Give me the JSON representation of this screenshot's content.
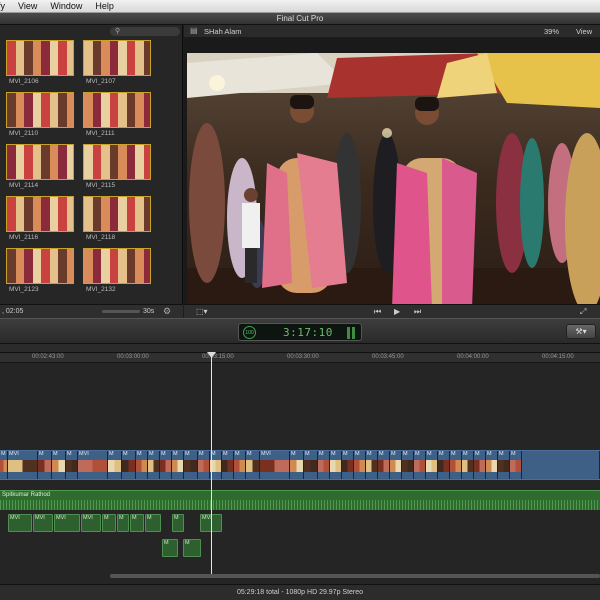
{
  "menubar": {
    "items": [
      "fy",
      "View",
      "Window",
      "Help"
    ]
  },
  "app_title": "Final Cut Pro",
  "browser": {
    "clips": [
      {
        "label": "MVI_2106"
      },
      {
        "label": "MVI_2107"
      },
      {
        "label": "MVI_2110"
      },
      {
        "label": "MVI_2111"
      },
      {
        "label": "MVI_2114"
      },
      {
        "label": "MVI_2115"
      },
      {
        "label": "MVI_2116"
      },
      {
        "label": "MVI_2118"
      },
      {
        "label": "MVI_2123"
      },
      {
        "label": "MVI_2132"
      }
    ],
    "duration": ", 02:05",
    "zoom_label": "30s"
  },
  "viewer": {
    "clip_name": "SHah Alam",
    "zoom": "39%",
    "view_label": "View"
  },
  "dashboard": {
    "percent": "100",
    "timecode": "3:17:10"
  },
  "timeline": {
    "ruler_ticks": [
      "00:02:43:00",
      "00:03:00:00",
      "00:03:15:00",
      "00:03:30:00",
      "00:03:45:00",
      "00:04:00:00",
      "00:04:15:00"
    ],
    "audio_label": "Spitkumar Rathod",
    "clip_prefix": "MVI",
    "clip_short": "M"
  },
  "status": "05:29:18 total - 1080p HD 29.97p Stereo",
  "colors": {
    "storyline": "#3e5f86",
    "audio": "#2f6a2f",
    "timecode": "#6bbd6b"
  }
}
